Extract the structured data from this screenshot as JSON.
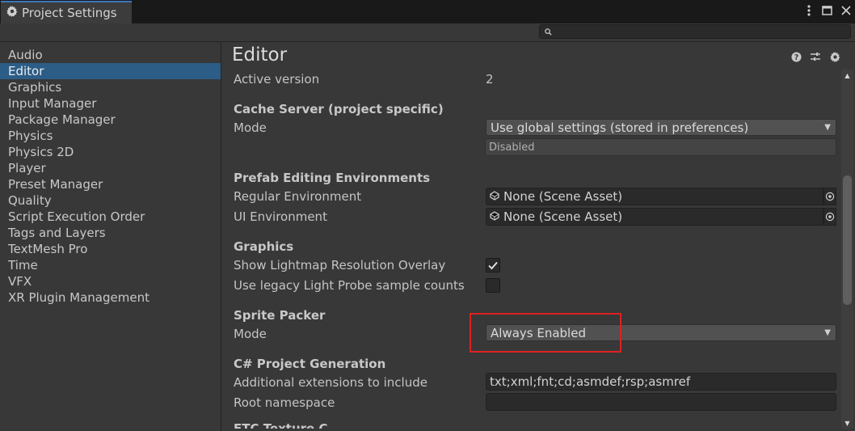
{
  "window": {
    "title": "Project Settings",
    "icons": {
      "tab": "gear-icon",
      "menu": "more-vertical-icon",
      "maximize": "maximize-icon",
      "close": "close-icon"
    },
    "accent_color": "#3a79bb"
  },
  "search": {
    "value": "",
    "placeholder": "",
    "icon": "search-icon"
  },
  "sidebar": {
    "items": [
      {
        "label": "Audio",
        "selected": false
      },
      {
        "label": "Editor",
        "selected": true
      },
      {
        "label": "Graphics",
        "selected": false
      },
      {
        "label": "Input Manager",
        "selected": false
      },
      {
        "label": "Package Manager",
        "selected": false
      },
      {
        "label": "Physics",
        "selected": false
      },
      {
        "label": "Physics 2D",
        "selected": false
      },
      {
        "label": "Player",
        "selected": false
      },
      {
        "label": "Preset Manager",
        "selected": false
      },
      {
        "label": "Quality",
        "selected": false
      },
      {
        "label": "Script Execution Order",
        "selected": false
      },
      {
        "label": "Tags and Layers",
        "selected": false
      },
      {
        "label": "TextMesh Pro",
        "selected": false
      },
      {
        "label": "Time",
        "selected": false
      },
      {
        "label": "VFX",
        "selected": false
      },
      {
        "label": "XR Plugin Management",
        "selected": false
      }
    ],
    "selected_color": "#2c5d87"
  },
  "main": {
    "title": "Editor",
    "header_icons": [
      "help-icon",
      "preset-icon",
      "settings-icon"
    ],
    "active_version": {
      "label": "Active version",
      "value": "2"
    },
    "cache_server": {
      "header": "Cache Server (project specific)",
      "mode_label": "Mode",
      "mode_value": "Use global settings (stored in preferences)",
      "status": "Disabled"
    },
    "prefab": {
      "header": "Prefab Editing Environments",
      "regular_label": "Regular Environment",
      "regular_value": "None (Scene Asset)",
      "ui_label": "UI Environment",
      "ui_value": "None (Scene Asset)"
    },
    "graphics": {
      "header": "Graphics",
      "lightmap_label": "Show Lightmap Resolution Overlay",
      "lightmap_checked": true,
      "light_probe_label": "Use legacy Light Probe sample counts",
      "light_probe_checked": false
    },
    "sprite_packer": {
      "header": "Sprite Packer",
      "mode_label": "Mode",
      "mode_value": "Always Enabled",
      "highlight_color": "#e02020"
    },
    "csharp": {
      "header": "C# Project Generation",
      "extensions_label": "Additional extensions to include",
      "extensions_value": "txt;xml;fnt;cd;asmdef;rsp;asmref",
      "namespace_label": "Root namespace",
      "namespace_value": ""
    },
    "partial_header": "ETC Texture C"
  }
}
